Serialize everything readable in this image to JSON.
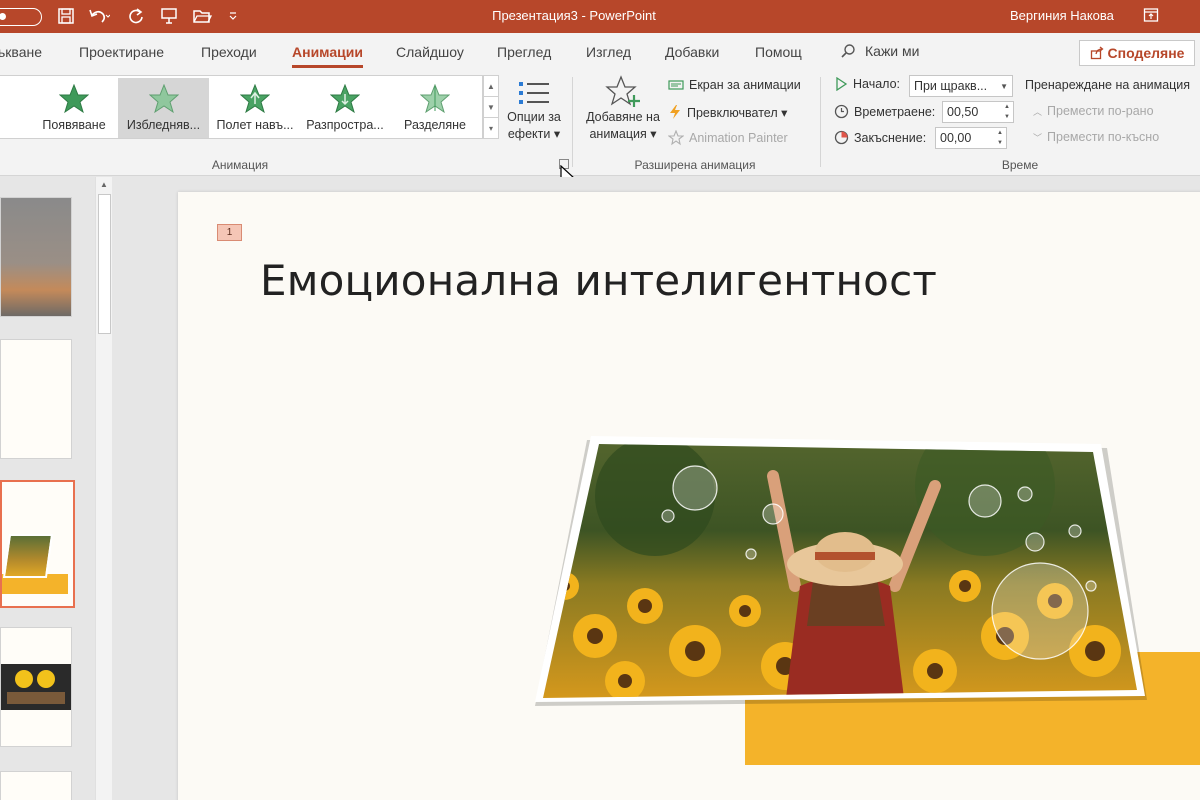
{
  "titlebar": {
    "title": "Презентация3  -  PowerPoint",
    "user": "Вергиния Накова"
  },
  "tabs": [
    {
      "label": "ькване",
      "active": false
    },
    {
      "label": "Проектиране",
      "active": false
    },
    {
      "label": "Преходи",
      "active": false
    },
    {
      "label": "Анимации",
      "active": true
    },
    {
      "label": "Слайдшоу",
      "active": false
    },
    {
      "label": "Преглед",
      "active": false
    },
    {
      "label": "Изглед",
      "active": false
    },
    {
      "label": "Добавки",
      "active": false
    },
    {
      "label": "Помощ",
      "active": false
    }
  ],
  "tell_me": "Кажи ми",
  "share": "Споделяне",
  "animation_gallery": {
    "items": [
      {
        "label": "Появяване",
        "selected": false
      },
      {
        "label": "Избледняв...",
        "selected": true
      },
      {
        "label": "Полет навъ...",
        "selected": false
      },
      {
        "label": "Разпростра...",
        "selected": false
      },
      {
        "label": "Разделяне",
        "selected": false
      }
    ],
    "effect_options": [
      "Опции за",
      "ефекти ▾"
    ],
    "group_label": "Анимация"
  },
  "advanced_animation": {
    "add_animation": [
      "Добавяне на",
      "анимация ▾"
    ],
    "animation_pane": "Екран за анимации",
    "trigger": "Превключвател ▾",
    "painter": "Animation Painter",
    "group_label": "Разширена анимация"
  },
  "timing": {
    "start_label": "Начало:",
    "start_value": "При щракв...",
    "duration_label": "Времетраене:",
    "duration_value": "00,50",
    "delay_label": "Закъснение:",
    "delay_value": "00,00",
    "reorder_label": "Пренареждане на анимация",
    "move_earlier": "Премести по-рано",
    "move_later": "Премести по-късно",
    "group_label": "Време"
  },
  "slide": {
    "animation_tag": "1",
    "title": "Емоционална интелигентност"
  },
  "colors": {
    "accent": "#b7472a",
    "slide_bg": "#fcfaf5",
    "yellow": "#f4b32a"
  }
}
